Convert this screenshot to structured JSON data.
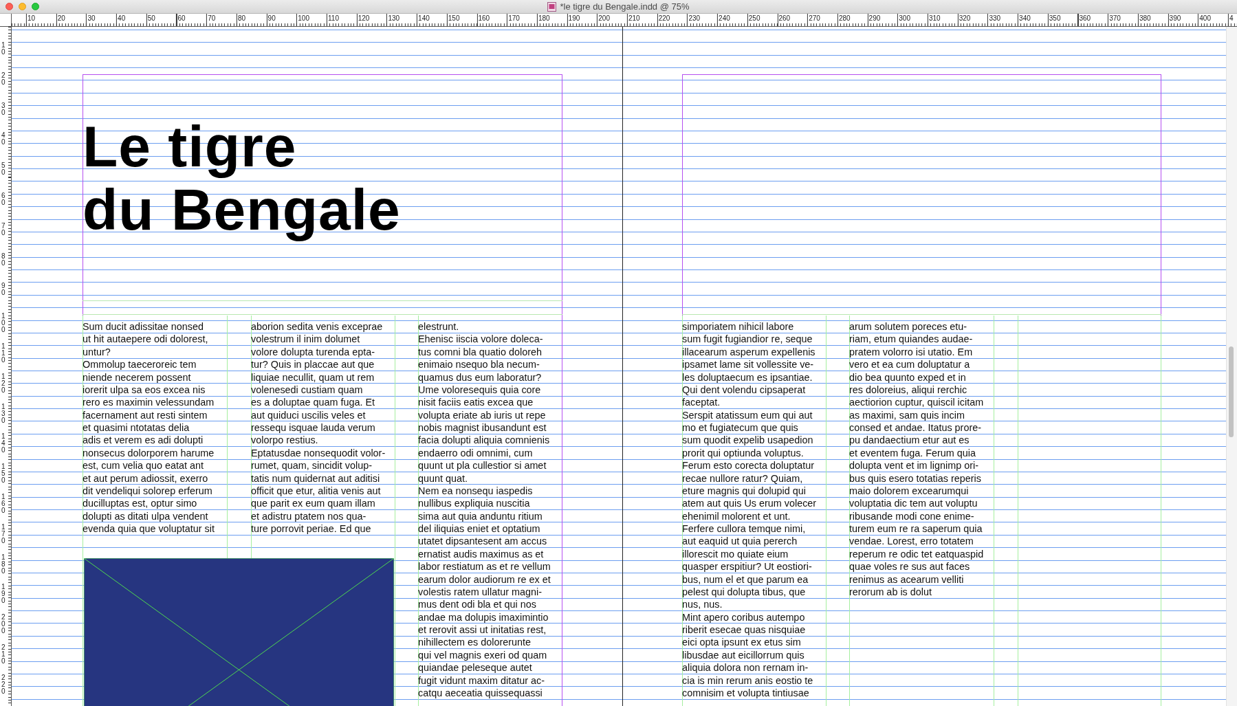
{
  "window": {
    "title": "*le tigre du Bengale.indd @ 75%"
  },
  "ruler": {
    "horizontal": [
      "10",
      "20",
      "30",
      "40",
      "50",
      "60",
      "70",
      "80",
      "90",
      "100",
      "110",
      "120",
      "130",
      "140",
      "150",
      "160",
      "170",
      "180",
      "190",
      "200",
      "210",
      "220",
      "230",
      "240",
      "250",
      "260",
      "270",
      "280",
      "290",
      "300",
      "310",
      "320",
      "330",
      "340",
      "350",
      "360",
      "370",
      "380",
      "390",
      "400",
      "4"
    ],
    "vertical": [
      "10",
      "20",
      "30",
      "40",
      "50",
      "60",
      "70",
      "80",
      "90",
      "100",
      "110",
      "120",
      "130",
      "140",
      "150",
      "160",
      "170",
      "180",
      "190",
      "200",
      "210",
      "220"
    ]
  },
  "left_page": {
    "title": "Le tigre\ndu Bengale",
    "columns": [
      {
        "paragraphs": [
          "Sum ducit adissitae nonsed\nut hit autaepere odi dolorest,\nuntur?",
          "Ommolup taeceroreic tem\nniende necerem possent\niorerit ulpa sa eos excea nis\nrero es maximin velessundam\nfacernament aut resti sintem\net quasimi ntotatas delia\nadis et verem es adi dolupti\nnonsecus dolorporem harume\nest, cum velia quo eatat ant\net aut perum adiossit, exerro\ndit vendeliqui solorep erferum\nducilluptas est, optur simo\ndolupti as ditati ulpa vendent\nevenda quia que voluptatur sit"
        ]
      },
      {
        "paragraphs": [
          "aborion sedita venis exceprae\nvolestrum il inim dolumet\nvolore dolupta turenda epta-\ntur? Quis in placcae aut que\nliquiae necullit, quam ut rem\nvolenesedi custiam quam\nes a doluptae quam fuga. Et\naut quiduci uscilis veles et\nressequ isquae lauda verum\nvolorpo restius.",
          "Eptatusdae nonsequodit volor-\nrumet, quam, sincidit volup-\ntatis num quidernat aut aditisi\nofficit que etur, alitia venis aut\nque parit ex eum quam illam\net adistru ptatem nos qua-\nture porrovit periae. Ed que"
        ]
      },
      {
        "paragraphs": [
          "elestrunt.",
          "Ehenisc iiscia volore doleca-\ntus comni bla quatio doloreh\nenimaio nsequo bla necum-\nquamus dus eum laboratur?\nUme voloresequis quia core\nnisit faciis eatis excea que\nvolupta eriate ab iuris ut repe\nnobis magnist ibusandunt est\nfacia dolupti aliquia comnienis\nendaerro odi omnimi, cum\nquunt ut pla cullestior si amet\nquunt quat.",
          "Nem ea nonsequ iaspedis\nnullibus expliquia nuscitia\nsima aut quia anduntu ritium\ndel iliquias eniet et optatium\nutatet dipsantesent am accus\nernatist audis maximus as et\nlabor restiatum as et re vellum\nearum dolor audiorum re ex et\nvolestis ratem ullatur magni-\nmus dent odi bla et qui nos\nandae ma dolupis imaximintio\net rerovit assi ut initatias rest,\nnihillectem es dolorerunte\nqui vel magnis exeri od quam\nquiandae peleseque autet\nfugit vidunt maxim ditatur ac-\ncatqu aeceatia quissequassi"
        ]
      }
    ],
    "image_frame": {
      "kind": "placeholder"
    }
  },
  "right_page": {
    "columns": [
      {
        "paragraphs": [
          "simporiatem nihicil labore\nsum fugit fugiandior re, seque\nillacearum asperum expellenis\nipsamet lame sit vollessite ve-\nles doluptaecum es ipsantiae.\nQui dent volendu cipsaperat\nfaceptat.",
          "Serspit atatissum eum qui aut\nmo et fugiatecum que quis\nsum quodit expelib usapedion\nprorit qui optiunda voluptus.\nFerum esto corecta doluptatur\nrecae nullore ratur? Quiam,\neture magnis qui dolupid qui\natem aut quis Us erum volecer\nehenimil molorent et unt.\nFerfere cullora temque nimi,\naut eaquid ut quia pererch\nillorescit mo quiate eium\nquasper erspitiur? Ut eostiori-\nbus, num el et que parum ea\npelest qui dolupta tibus, que\nnus, nus.",
          "Mint apero coribus autempo\nriberit esecae quas nisquiae\neici opta ipsunt ex etus sim\nlibusdae aut eicillorrum quis\naliquia dolora non rernam in-\ncia is min rerum anis eostio te\ncomnisim et volupta tintiusae"
        ]
      },
      {
        "paragraphs": [
          "arum solutem poreces etu-\nriam, etum quiandes audae-\npratem volorro isi utatio. Em\nvero et ea cum doluptatur a\ndio bea quunto exped et in\nres doloreius, aliqui rerchic\naectiorion cuptur, quiscil icitam\nas maximi, sam quis incim\nconsed et andae. Itatus prore-\npu dandaectium etur aut es\net eventem fuga. Ferum quia\ndolupta vent et im lignimp ori-\nbus quis esero totatias reperis\nmaio dolorem excearumqui\nvoluptatia dic tem aut voluptu\nribusande modi cone enime-\nturem eum re ra saperum quia\nvendae. Lorest, erro totatem\nreperum re odic tet eatquaspid\nquae voles re sus aut faces\nrenimus as acearum velliti\nrerorum ab is dolut"
        ]
      }
    ]
  }
}
